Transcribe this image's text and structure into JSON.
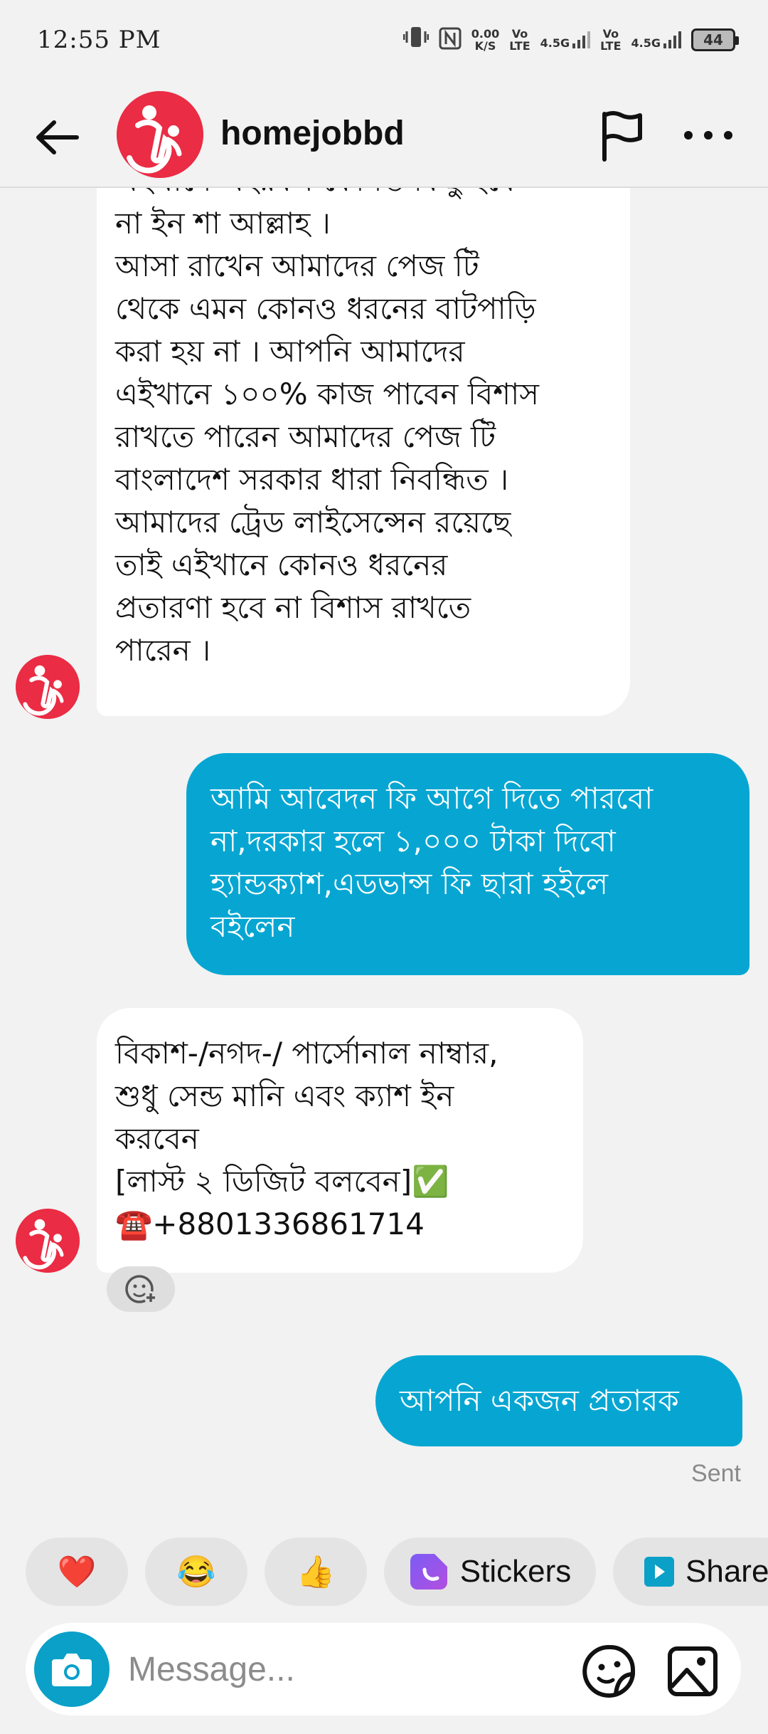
{
  "status_bar": {
    "time": "12:55 PM",
    "speed_value": "0.00",
    "speed_unit": "K/S",
    "sim1_top": "Vo",
    "sim1_bottom": "LTE",
    "sim1_net": "4.5G",
    "sim2_top": "Vo",
    "sim2_bottom": "LTE",
    "sim2_net": "4.5G",
    "battery": "44"
  },
  "header": {
    "name": "homejobbd"
  },
  "messages": [
    {
      "direction": "incoming",
      "text": "এইখানে এইরকম কোনও কিছু হবে\nনা ইন শা আল্লাহ ।\nআসা রাখেন আমাদের পেজ টি\nথেকে এমন কোনও ধরনের বাটপাড়ি\nকরা হয় না । আপনি আমাদের\nএইখানে ১০০% কাজ পাবেন বিশাস\nরাখতে পারেন আমাদের পেজ টি\nবাংলাদেশ সরকার ধারা নিবন্ধিত ।\nআমাদের ট্রেড লাইসেন্সেন রয়েছে\nতাই এইখানে কোনও ধরনের\nপ্রতারণা হবে না বিশাস রাখতে\nপারেন ।"
    },
    {
      "direction": "outgoing",
      "text": "আমি আবেদন ফি আগে দিতে পারবো\nনা,দরকার হলে ১,০০০ টাকা দিবো\nহ্যান্ডক্যাশ,এডভান্স ফি ছারা হইলে\nবইলেন"
    },
    {
      "direction": "incoming",
      "text": "বিকাশ-/নগদ-/ পার্সোনাল নাম্বার,\nশুধু সেন্ড মানি এবং ক্যাশ ইন\nকরবেন\n[লাস্ট ২ ডিজিট বলবেন]✅\n☎️+8801336861714"
    },
    {
      "direction": "outgoing",
      "text": "আপনি একজন প্রতারক"
    }
  ],
  "sent_status": "Sent",
  "quick_replies": {
    "heart": "❤️",
    "laugh": "😂",
    "thumbs_up": "👍",
    "stickers": "Stickers",
    "share": "Share"
  },
  "composer": {
    "placeholder": "Message..."
  },
  "colors": {
    "outgoing_bubble": "#07a6d2",
    "avatar": "#ea2c44",
    "camera": "#0aa0c8"
  }
}
